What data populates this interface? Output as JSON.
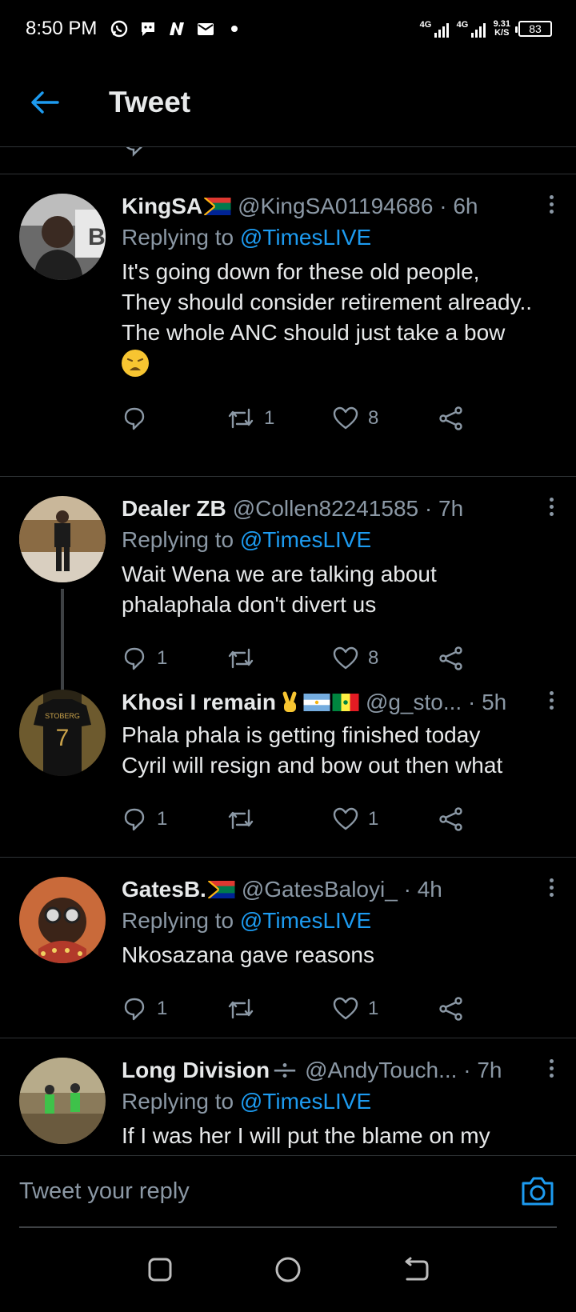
{
  "status_bar": {
    "time": "8:50 PM",
    "net1": "4G",
    "net2": "4G",
    "speed_value": "9.31",
    "speed_unit": "K/S",
    "battery": "83"
  },
  "header": {
    "title": "Tweet"
  },
  "tweets": [
    {
      "name": "KingSA",
      "handle": "@KingSA01194686",
      "time": "6h",
      "replying_prefix": "Replying to",
      "replying_to": "@TimesLIVE",
      "body": "It's going down for these old people,\nThey should consider retirement already..\nThe whole ANC should just take a bow",
      "replies": "",
      "retweets": "1",
      "likes": "8"
    },
    {
      "name": "Dealer ZB",
      "handle": "@Collen82241585",
      "time": "7h",
      "replying_prefix": "Replying to",
      "replying_to": "@TimesLIVE",
      "body": "Wait Wena we are talking about phalaphala don't divert us",
      "replies": "1",
      "retweets": "",
      "likes": "8"
    },
    {
      "name": "Khosi I remain",
      "handle": "@g_sto...",
      "time": "5h",
      "body": "Phala phala is getting finished today\nCyril will resign and bow out then what",
      "replies": "1",
      "retweets": "",
      "likes": "1"
    },
    {
      "name": "GatesB.",
      "handle": "@GatesBaloyi_",
      "time": "4h",
      "replying_prefix": "Replying to",
      "replying_to": "@TimesLIVE",
      "body": "Nkosazana gave reasons",
      "replies": "1",
      "retweets": "",
      "likes": "1"
    },
    {
      "name": "Long Division",
      "handle": "@AndyTouch...",
      "time": "7h",
      "replying_prefix": "Replying to",
      "replying_to": "@TimesLIVE",
      "body": "If I was her I will put the blame on my"
    }
  ],
  "reply_box": {
    "placeholder": "Tweet your reply"
  },
  "colors": {
    "accent": "#1d9bf0",
    "muted": "#8b98a5",
    "background": "#000000"
  }
}
